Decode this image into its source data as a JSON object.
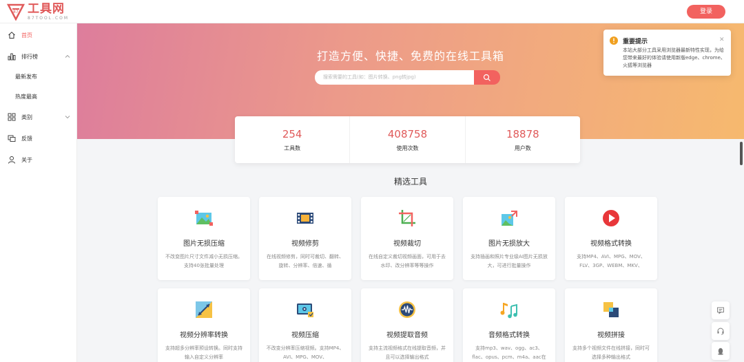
{
  "header": {
    "logo_title": "工具网",
    "logo_subtitle": "87TOOL.COM",
    "login_label": "登录"
  },
  "sidebar": {
    "home": "首页",
    "ranking": "排行榜",
    "ranking_sub": [
      "最新发布",
      "热度最高"
    ],
    "category": "类别",
    "feedback": "反馈",
    "about": "关于"
  },
  "hero": {
    "title": "打造方便、快捷、免费的在线工具箱",
    "search_placeholder": "搜索需要的工具(如：图片转换、png转jpg)"
  },
  "stats": [
    {
      "value": "254",
      "label": "工具数"
    },
    {
      "value": "408758",
      "label": "使用次数"
    },
    {
      "value": "18878",
      "label": "用户数"
    }
  ],
  "section_title": "精选工具",
  "tools": [
    {
      "title": "图片无损压缩",
      "desc": "不改变图片尺寸文件减小无损压缩。支持40张批量处理",
      "icon": "image-compress-icon"
    },
    {
      "title": "视频修剪",
      "desc": "在线视频修剪，同时可裁切、翻转、旋转、分辨率、倍速、循",
      "icon": "video-trim-icon"
    },
    {
      "title": "视频裁切",
      "desc": "在线自定义裁切视频画面，可用于去水印、改分辨率等等操作",
      "icon": "video-crop-icon"
    },
    {
      "title": "图片无损放大",
      "desc": "支持插画和照片专业级AI图片无损放大，可进行批量操作",
      "icon": "image-enlarge-icon"
    },
    {
      "title": "视频格式转换",
      "desc": "支持MP4、AVI、MPG、MOV、FLV、3GP、WEBM、MKV、",
      "icon": "video-convert-icon"
    },
    {
      "title": "视频分辨率转换",
      "desc": "支持超多分辨率预设转换。同时支持输入自定义分辨率",
      "icon": "video-resolution-icon"
    },
    {
      "title": "视频压缩",
      "desc": "不改变分辨率压缩视频。支持MP4、AVI、MPG、MOV、",
      "icon": "video-compress-icon"
    },
    {
      "title": "视频提取音频",
      "desc": "支持主流视频格式在线提取音频，并且可以选择输出格式",
      "icon": "audio-extract-icon"
    },
    {
      "title": "音频格式转换",
      "desc": "支持mp3、wav、ogg、ac3、flac、opus、pcm、m4a、aac在",
      "icon": "audio-convert-icon"
    },
    {
      "title": "视频拼接",
      "desc": "支持多个视频文件在线拼接，同时可选择多种输出格式",
      "icon": "video-merge-icon"
    }
  ],
  "notice": {
    "title": "重要提示",
    "body": "本站大部分工具采用浏览器最新特性实现，为给您带来最好的体验请使用新版edge、chrome、火狐等浏览器"
  },
  "colors": {
    "accent": "#f2625f",
    "stat_value": "#e05a5a",
    "hero_left": "#dd7d9c",
    "hero_right": "#f6b96e"
  }
}
